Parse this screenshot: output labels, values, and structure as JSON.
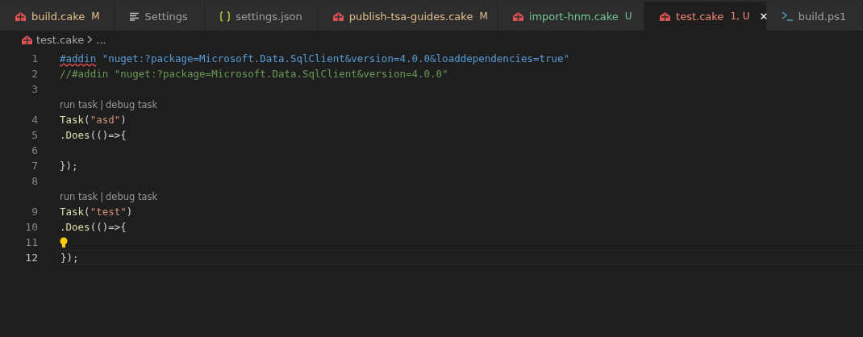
{
  "tabs": [
    {
      "label": "build.cake",
      "kind": "cake",
      "badge": "M",
      "color": "#e2c08d",
      "selected": false
    },
    {
      "label": "Settings",
      "kind": "lines",
      "color": "#a0a0a0",
      "selected": false
    },
    {
      "label": "settings.json",
      "kind": "braces",
      "color": "#a0a0a0",
      "selected": false
    },
    {
      "label": "publish-tsa-guides.cake",
      "kind": "cake",
      "badge": "M",
      "color": "#e2c08d",
      "selected": false
    },
    {
      "label": "import-hnm.cake",
      "kind": "cake",
      "badge": "U",
      "color": "#73c991",
      "selected": false
    },
    {
      "label": "test.cake",
      "kind": "cake",
      "badge": "1, U",
      "color": "#f48771",
      "selected": true,
      "close": "✕"
    },
    {
      "label": "build.ps1",
      "kind": "terminal",
      "color": "#a0a0a0",
      "selected": false
    }
  ],
  "breadcrumb": {
    "file": "test.cake",
    "rest": "..."
  },
  "lines": [
    {
      "kind": "code",
      "number": "1",
      "current": false,
      "tokens": [
        {
          "text": "#addin",
          "kind": "keyword",
          "error": true
        },
        {
          "text": " \"nuget:?package=Microsoft.Data.SqlClient&version=4.0.0&loaddependencies=true\"",
          "kind": "keyword"
        }
      ]
    },
    {
      "kind": "code",
      "number": "2",
      "current": false,
      "tokens": [
        {
          "text": "//#addin \"nuget:?package=Microsoft.Data.SqlClient&version=4.0.0\"",
          "kind": "comment"
        }
      ]
    },
    {
      "kind": "code",
      "number": "3",
      "current": false
    },
    {
      "kind": "codelens",
      "actions": [
        "run task",
        "debug task"
      ],
      "separator": "|"
    },
    {
      "kind": "code",
      "number": "4",
      "current": false,
      "tokens": [
        {
          "text": "Task",
          "kind": "function"
        },
        {
          "text": "(",
          "kind": "plain"
        },
        {
          "text": "\"asd\"",
          "kind": "string"
        },
        {
          "text": ")",
          "kind": "plain"
        }
      ]
    },
    {
      "kind": "code",
      "number": "5",
      "current": false,
      "tokens": [
        {
          "text": ".Does",
          "kind": "function"
        },
        {
          "text": "(()=>{",
          "kind": "plain"
        }
      ]
    },
    {
      "kind": "code",
      "number": "6",
      "current": false
    },
    {
      "kind": "code",
      "number": "7",
      "current": false,
      "tokens": [
        {
          "text": "});",
          "kind": "plain"
        }
      ]
    },
    {
      "kind": "code",
      "number": "8",
      "current": false
    },
    {
      "kind": "codelens",
      "actions": [
        "run task",
        "debug task"
      ],
      "separator": "|"
    },
    {
      "kind": "code",
      "number": "9",
      "current": false,
      "tokens": [
        {
          "text": "Task",
          "kind": "function"
        },
        {
          "text": "(",
          "kind": "plain"
        },
        {
          "text": "\"test\"",
          "kind": "string"
        },
        {
          "text": ")",
          "kind": "plain"
        }
      ]
    },
    {
      "kind": "code",
      "number": "10",
      "current": false,
      "tokens": [
        {
          "text": ".Does",
          "kind": "function"
        },
        {
          "text": "(()=>{",
          "kind": "plain"
        }
      ]
    },
    {
      "kind": "code",
      "number": "11",
      "current": false,
      "lightbulb": true
    },
    {
      "kind": "code",
      "number": "12",
      "current": true,
      "tokens": [
        {
          "text": "});",
          "kind": "plain"
        }
      ]
    }
  ]
}
